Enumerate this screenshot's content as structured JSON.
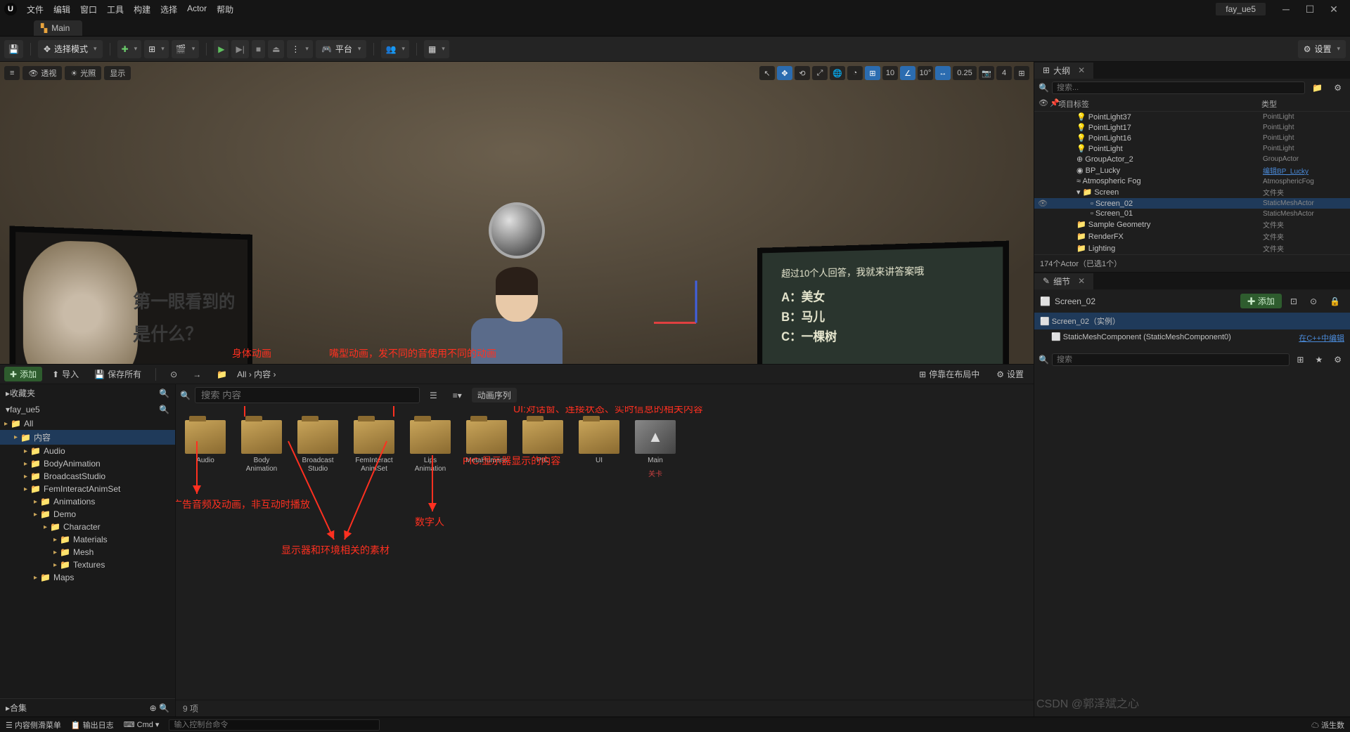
{
  "menu": [
    "文件",
    "编辑",
    "窗口",
    "工具",
    "构建",
    "选择",
    "Actor",
    "帮助"
  ],
  "project_name": "fay_ue5",
  "main_tab": "Main",
  "toolbar": {
    "save": "保存",
    "mode": "选择模式",
    "platform": "平台",
    "settings": "设置"
  },
  "viewport": {
    "pills": [
      "透视",
      "光照",
      "显示"
    ],
    "grid_val": "10",
    "angle_val": "10°",
    "scale_val": "0.25",
    "cam_val": "4",
    "screen_l_line1": "第一眼看到的",
    "screen_l_line2": "是什么？",
    "screen_r_q": "超过10个人回答，我就来讲答案哦",
    "screen_r_a": "A：美女",
    "screen_r_b": "B：马儿",
    "screen_r_c": "C：一棵树"
  },
  "annotations": {
    "body_anim": "身体动画",
    "lips_anim": "嘴型动画，发不同的音使用不同的动画",
    "ui_note": "UI:对话窗、连接状态、实时信息的相关内容",
    "pic_note": "PIC:显示器显示的内容",
    "audio_note": "广告音频及动画，非互动时播放",
    "digital_human": "数字人",
    "env_note": "显示器和环境相关的素材"
  },
  "content_browser": {
    "add": "添加",
    "import": "导入",
    "save_all": "保存所有",
    "breadcrumb": [
      "All",
      "内容"
    ],
    "favorites": "收藏夹",
    "project": "fay_ue5",
    "search_ph": "搜索 内容",
    "anim_seq": "动画序列",
    "tree": [
      {
        "label": "All",
        "depth": 0
      },
      {
        "label": "内容",
        "depth": 1,
        "sel": true
      },
      {
        "label": "Audio",
        "depth": 2
      },
      {
        "label": "BodyAnimation",
        "depth": 2
      },
      {
        "label": "BroadcastStudio",
        "depth": 2
      },
      {
        "label": "FemInteractAnimSet",
        "depth": 2
      },
      {
        "label": "Animations",
        "depth": 3
      },
      {
        "label": "Demo",
        "depth": 3
      },
      {
        "label": "Character",
        "depth": 4
      },
      {
        "label": "Materials",
        "depth": 5
      },
      {
        "label": "Mesh",
        "depth": 5
      },
      {
        "label": "Textures",
        "depth": 5
      },
      {
        "label": "Maps",
        "depth": 3
      }
    ],
    "collections": "合集",
    "assets": [
      {
        "name": "Audio",
        "type": "folder"
      },
      {
        "name": "Body Animation",
        "type": "folder"
      },
      {
        "name": "Broadcast Studio",
        "type": "folder"
      },
      {
        "name": "FemInteract AnimSet",
        "type": "folder"
      },
      {
        "name": "Lips Animation",
        "type": "folder"
      },
      {
        "name": "MetaHumans",
        "type": "folder"
      },
      {
        "name": "PIC",
        "type": "folder"
      },
      {
        "name": "UI",
        "type": "folder"
      },
      {
        "name": "Main",
        "type": "level",
        "subtype": "关卡"
      }
    ],
    "count": "9 项",
    "dock_label": "停靠在布局中",
    "bottom_settings": "设置"
  },
  "outliner": {
    "title": "大纲",
    "search_ph": "搜索...",
    "col1": "项目标签",
    "col2": "类型",
    "rows": [
      {
        "icon": "💡",
        "label": "PointLight37",
        "type": "PointLight",
        "indent": 40
      },
      {
        "icon": "💡",
        "label": "PointLight17",
        "type": "PointLight",
        "indent": 40
      },
      {
        "icon": "💡",
        "label": "PointLight16",
        "type": "PointLight",
        "indent": 40
      },
      {
        "icon": "💡",
        "label": "PointLight",
        "type": "PointLight",
        "indent": 40
      },
      {
        "icon": "⊕",
        "label": "GroupActor_2",
        "type": "GroupActor",
        "indent": 40
      },
      {
        "icon": "◉",
        "label": "BP_Lucky",
        "type": "编辑BP_Lucky",
        "indent": 40,
        "link": true
      },
      {
        "icon": "≈",
        "label": "Atmospheric Fog",
        "type": "AtmosphericFog",
        "indent": 40
      },
      {
        "icon": "📁",
        "label": "Screen",
        "type": "文件夹",
        "indent": 40,
        "exp": true
      },
      {
        "icon": "▫",
        "label": "Screen_02",
        "type": "StaticMeshActor",
        "indent": 60,
        "sel": true,
        "eye": true
      },
      {
        "icon": "▫",
        "label": "Screen_01",
        "type": "StaticMeshActor",
        "indent": 60
      },
      {
        "icon": "📁",
        "label": "Sample Geometry",
        "type": "文件夹",
        "indent": 40
      },
      {
        "icon": "📁",
        "label": "RenderFX",
        "type": "文件夹",
        "indent": 40
      },
      {
        "icon": "📁",
        "label": "Lighting",
        "type": "文件夹",
        "indent": 40
      }
    ],
    "status": "174个Actor（已选1个）"
  },
  "details": {
    "title": "细节",
    "obj": "Screen_02",
    "add": "添加",
    "instance": "Screen_02（实例）",
    "component": "StaticMeshComponent (StaticMeshComponent0)",
    "edit_cpp": "在C++中编辑",
    "search_ph": "搜索"
  },
  "statusbar": {
    "drawer": "内容侧滑菜单",
    "log": "输出日志",
    "cmd": "Cmd",
    "cmd_ph": "输入控制台命令",
    "derived": "派生数",
    "watermark": "CSDN @郭泽斌之心"
  }
}
